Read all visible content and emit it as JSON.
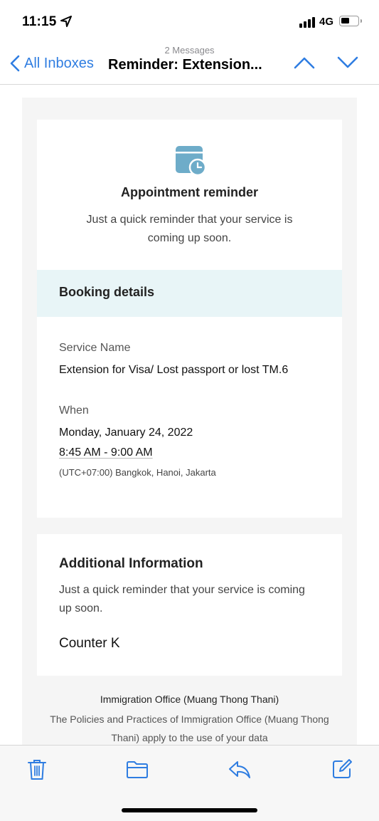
{
  "status_bar": {
    "time": "11:15",
    "network": "4G"
  },
  "nav": {
    "message_count": "2 Messages",
    "back_label": "All Inboxes",
    "subject": "Reminder: Extension..."
  },
  "email": {
    "appointment_title": "Appointment reminder",
    "appointment_subtitle": "Just a quick reminder that your service is coming up soon.",
    "booking_title": "Booking details",
    "service_label": "Service Name",
    "service_value": "Extension for Visa/ Lost passport or lost TM.6",
    "when_label": "When",
    "date": "Monday, January 24, 2022",
    "time": "8:45 AM - 9:00 AM",
    "timezone": "(UTC+07:00) Bangkok, Hanoi, Jakarta",
    "additional_title": "Additional Information",
    "additional_body": "Just a quick reminder that your service is coming up soon.",
    "counter": "Counter K",
    "office_name": "Immigration Office (Muang Thong Thani)",
    "policy_text": "The Policies and Practices of Immigration Office (Muang Thong Thani) apply to the use of your data"
  },
  "toolbar": {
    "icons": [
      "trash-icon",
      "folder-icon",
      "reply-icon",
      "compose-icon"
    ]
  },
  "colors": {
    "accent": "#2f7de1",
    "calendar_icon": "#6eacc9",
    "booking_band": "#e8f5f7"
  }
}
